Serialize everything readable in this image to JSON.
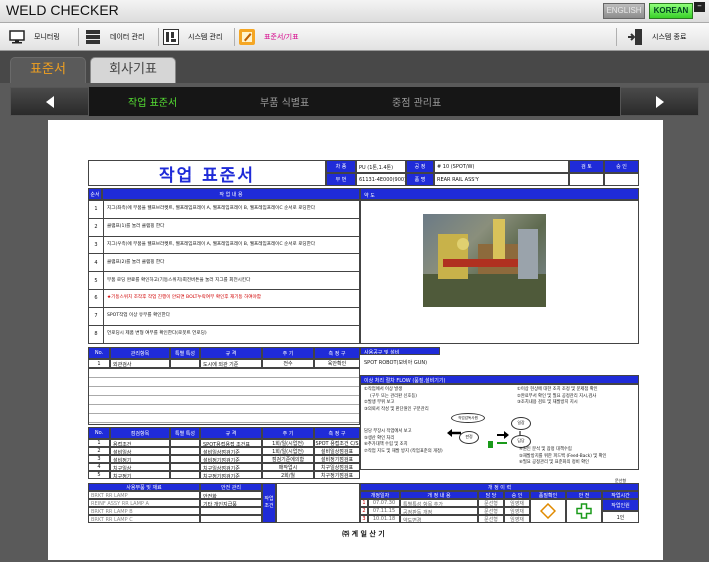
{
  "app": {
    "title": "WELD CHECKER",
    "lang_en": "ENGLISH",
    "lang_ko": "KOREAN"
  },
  "menu": [
    {
      "label": "모니터링",
      "icon": "monitor-icon"
    },
    {
      "label": "데이터 관리",
      "icon": "data-icon"
    },
    {
      "label": "시스템 관리",
      "icon": "system-icon"
    },
    {
      "label": "표준서/기표",
      "icon": "document-edit-icon"
    },
    {
      "label": "시스템 종료",
      "icon": "exit-icon"
    }
  ],
  "tabs": [
    "표준서",
    "회사기표"
  ],
  "nav": {
    "items": [
      "작업 표준서",
      "부품 식별표",
      "중점 관리표"
    ],
    "active": 0
  },
  "doc": {
    "title": "작업 표준서",
    "header": {
      "chasu_label": "차 종",
      "chasu": "PU (1톤,1.4톤)",
      "process_label": "공 정",
      "process": "# 10 (SPOT/W)",
      "part_no_label": "부 번",
      "part_no": "61131-4E000(900)",
      "part_name_label": "품 명",
      "part_name": "REAR RAIL ASS'Y",
      "review": "검 토",
      "approve": "승 인"
    },
    "steps_head": {
      "no": "순서",
      "content": "작 업 내 용",
      "drawing": "약 도"
    },
    "steps": [
      {
        "no": "1",
        "text": "지그(좌측)에 부품을 웰프브라켓트, 웰프레임프레이 A, 웰프레임프레이 B, 웰프레임프레이C 순서로 로딩한다"
      },
      {
        "no": "2",
        "text": "클램프(1)를 눌러 클램핑 한다"
      },
      {
        "no": "3",
        "text": "지그(우측)에 부품을 웰프브라켓트, 웰프레임프레이 A, 웰프레임프레이 B, 웰프레임프레이C 순서로 로딩한다"
      },
      {
        "no": "4",
        "text": "클램프(2)를 눌러 클램핑 한다"
      },
      {
        "no": "5",
        "text": "부품 로딩 완료를 확인하고(기동스위치)회전버튼을 눌러 지그를 회전시킨다"
      },
      {
        "no": "6",
        "text": "★기동스위치 조작후 작업 진행이 안되면 BOLT누락여부 확인후 재기동 하여야함",
        "warn": true
      },
      {
        "no": "7",
        "text": "SPOT작업 이상 유무를 확인한다"
      },
      {
        "no": "8",
        "text": "언로딩시 제품 변형 여부를 확인한다(로봇트 언로딩)"
      }
    ],
    "mgmt_head": {
      "no": "No.",
      "item": "관리항목",
      "special": "특별 특성",
      "spec": "규 격",
      "cycle": "주 기",
      "method": "측 정 구"
    },
    "mgmt_rows": [
      {
        "no": "1",
        "item": "외관검사",
        "special": "",
        "spec": "도시에 외관 기준",
        "cycle": "전수",
        "method": "육안확인"
      }
    ],
    "equip": {
      "label": "사용공구 및 설비",
      "value": "SPOT ROBOT(모비아 GUN)"
    },
    "check_head": {
      "no": "No.",
      "item": "점검항목",
      "special": "특별 특성",
      "spec": "규 격",
      "cycle": "주 기",
      "method": "측 정 구"
    },
    "check_rows": [
      {
        "no": "1",
        "item": "용접조건",
        "spec": "SPOT용접용접 조건표",
        "cycle": "1회/일(시업전)",
        "method": "SPOT 용접조건 C/S"
      },
      {
        "no": "2",
        "item": "설비일상",
        "spec": "설비일상점검기준",
        "cycle": "1회/일(시업전)",
        "method": "설비일상점검표"
      },
      {
        "no": "3",
        "item": "설비정기",
        "spec": "설비정기점검기준",
        "cycle": "점검기준에의함",
        "method": "설비정기점검표"
      },
      {
        "no": "4",
        "item": "치구일상",
        "spec": "치구일상점검기준",
        "cycle": "매작업시",
        "method": "치구일상점검표"
      },
      {
        "no": "5",
        "item": "치구정기",
        "spec": "치구정기점검기준",
        "cycle": "2회/월",
        "method": "치구정기점검표"
      }
    ],
    "flow": {
      "title": "이상 처리 절차 FLOW (품질,설비기기)",
      "left": [
        "①작업에서 이상 발생",
        "(구두 또는 관리판 신호등)",
        "②발생 부위 보고",
        "③의뢰서 작성 및 판단원인 구분관리",
        "⑤생산 확인 처리",
        "⑥추가대책 수립 및 조치",
        "⑦작업 지도 및 재발 방지 (작업표준의 개정)"
      ],
      "right": [
        "①이상 현상에 대한 조치 조정 및 문제점 확인",
        "②완료부서 확인 및 필요 공정관리 지시,검사",
        "③조치내용 검토 및 재발방지 지시",
        "④원인 분석 및 잠정 대책수립",
        "⑤재발방지를 위한 피드백 (Feed-Back) 및 확인",
        "⑥필요 공정관리 및 표준화의 정비 확인"
      ],
      "nodes": [
        "작업감독사원",
        "판정",
        "일장",
        "담당"
      ],
      "mid_labels": [
        "담당 부장시 작업에서 보고",
        "②발생 부위 보고"
      ]
    },
    "parts": {
      "head": [
        "사용부품 및 재료",
        "안전 관리",
        "작업 조건"
      ],
      "rows": [
        {
          "part": "BRKT RR LAMP",
          "safe": "안전화"
        },
        {
          "part": "REINF ASSY RR LAMP A",
          "safe": "기타 개인지급품"
        },
        {
          "part": "BRKT RR LAMP B",
          "safe": ""
        },
        {
          "part": "BRKT RR LAMP C",
          "safe": ""
        }
      ]
    },
    "revision": {
      "title": "개 정 이 력",
      "head": [
        "개정일자",
        "개 정 내 용",
        "담 당",
        "승 인",
        "품질확인",
        "안 전",
        "작업시간"
      ],
      "rows": [
        {
          "no": "1",
          "date": "07.07.30",
          "desc": "특별특성 항목 추가",
          "by": "문선형",
          "appr": "임영재"
        },
        {
          "no": "2",
          "date": "07.11.15",
          "desc": "공정판독 개정",
          "by": "문선형",
          "appr": "임영재"
        },
        {
          "no": "3",
          "date": "10.01.18",
          "desc": "약도변경",
          "by": "문선형",
          "appr": "임영재"
        }
      ],
      "approver": "문선형",
      "work_staff_label": "작업인원",
      "work_staff": "1인"
    },
    "company": "㈜ 계 일 산 기"
  }
}
